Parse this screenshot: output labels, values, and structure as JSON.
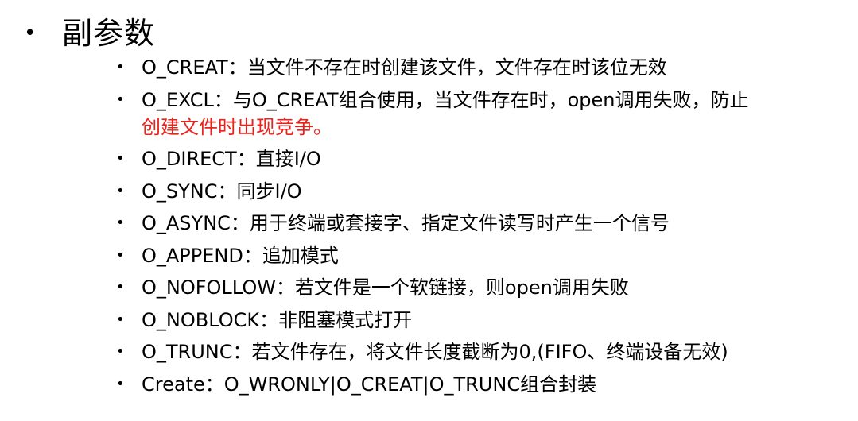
{
  "heading": {
    "bullet": "•",
    "title": "副参数"
  },
  "bullet_glyph": "•",
  "accent_red": "#e8231c",
  "items": [
    {
      "text": "O_CREAT：当文件不存在时创建该文件，文件存在时该位无效"
    },
    {
      "text": "O_EXCL：与O_CREAT组合使用，当文件存在时，open调用失败，防止",
      "continuation": "创建文件时出现竞争。"
    },
    {
      "text": "O_DIRECT：直接I/O"
    },
    {
      "text": "O_SYNC：同步I/O"
    },
    {
      "text": "O_ASYNC：用于终端或套接字、指定文件读写时产生一个信号"
    },
    {
      "text": "O_APPEND：追加模式"
    },
    {
      "text": "O_NOFOLLOW：若文件是一个软链接，则open调用失败"
    },
    {
      "text": "O_NOBLOCK：非阻塞模式打开"
    },
    {
      "text": "O_TRUNC：若文件存在，将文件长度截断为0,(FIFO、终端设备无效)"
    },
    {
      "text": "Create：O_WRONLY|O_CREAT|O_TRUNC组合封装"
    }
  ]
}
